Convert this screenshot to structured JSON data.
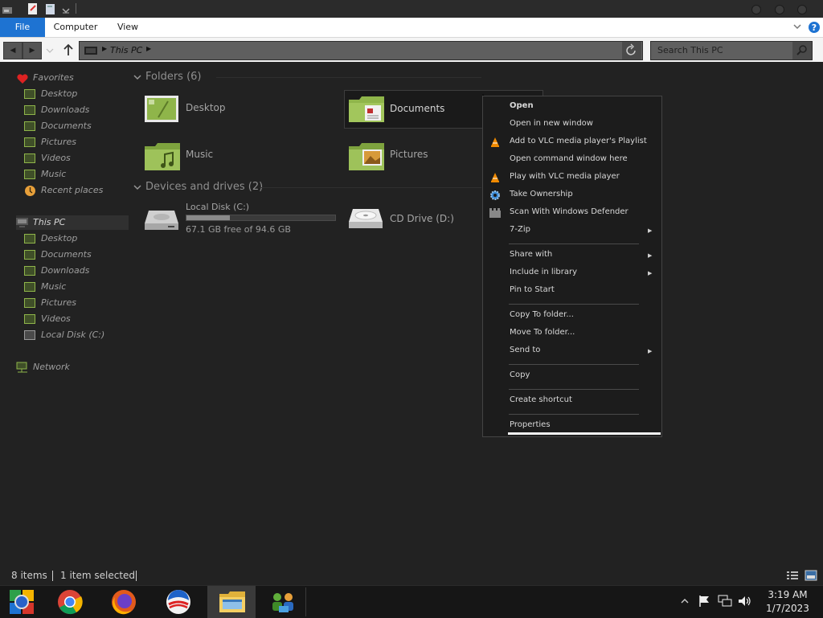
{
  "ribbon": {
    "tabs": [
      {
        "label": "File"
      },
      {
        "label": "Computer"
      },
      {
        "label": "View"
      }
    ],
    "help_icon": "help-icon"
  },
  "address": {
    "path_label": "This PC",
    "search_placeholder": "Search This PC"
  },
  "nav": {
    "favorites_header": "Favorites",
    "favorites": [
      "Desktop",
      "Downloads",
      "Documents",
      "Pictures",
      "Videos",
      "Music",
      "Recent places"
    ],
    "thispc_header": "This PC",
    "thispc": [
      "Desktop",
      "Documents",
      "Downloads",
      "Music",
      "Pictures",
      "Videos",
      "Local Disk (C:)"
    ],
    "network": "Network"
  },
  "content": {
    "folders_header": "Folders (6)",
    "folders": [
      "Desktop",
      "Documents",
      "Music",
      "Pictures"
    ],
    "devices_header": "Devices and drives (2)",
    "drive_c": {
      "name": "Local Disk (C:)",
      "free": "67.1 GB free of 94.6 GB",
      "used_fraction": 0.29
    },
    "drive_d": {
      "name": "CD Drive (D:)"
    }
  },
  "context_menu": {
    "items": [
      "Open",
      "Open in new window",
      "Add to VLC media player's Playlist",
      "Open command window here",
      "Play with VLC media player",
      "Take Ownership",
      "Scan With Windows Defender",
      "7-Zip",
      "Share with",
      "Include in library",
      "Pin to Start",
      "Copy To folder...",
      "Move To folder...",
      "Send to",
      "Copy",
      "Create shortcut",
      "Properties"
    ]
  },
  "status": {
    "items_count": "8 items",
    "selected": "1 item selected"
  },
  "taskbar": {
    "time": "3:19 AM",
    "date": "1/7/2023"
  },
  "colors": {
    "accent": "#1e73d2",
    "folder_green": "#8fb54a",
    "background": "#222222"
  }
}
